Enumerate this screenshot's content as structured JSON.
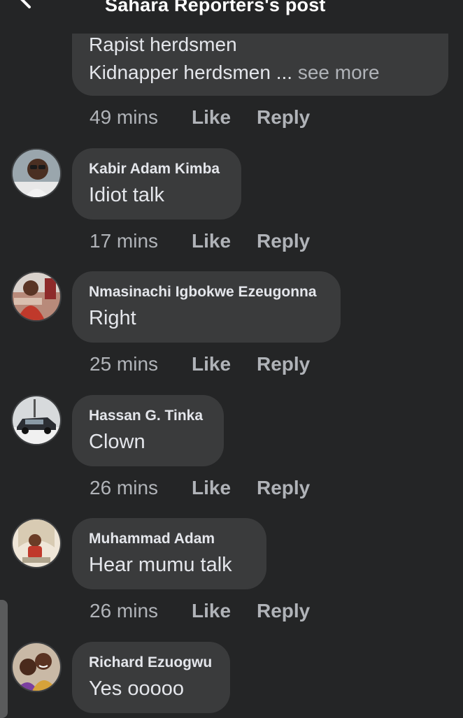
{
  "header": {
    "title": "Sahara Reporters's post"
  },
  "first_comment": {
    "lines": [
      "Rapist herdsmen",
      "Kidnapper herdsmen ..."
    ],
    "see_more": "see more",
    "time": "49 mins"
  },
  "actions": {
    "like": "Like",
    "reply": "Reply"
  },
  "comments": [
    {
      "author": "Kabir Adam Kimba",
      "text": "Idiot talk",
      "time": "17 mins",
      "avatar": "avatar-man-glasses"
    },
    {
      "author": "Nmasinachi Igbokwe Ezeugonna",
      "text": "Right",
      "time": "25 mins",
      "avatar": "avatar-woman-red"
    },
    {
      "author": "Hassan G. Tinka",
      "text": "Clown",
      "time": "26 mins",
      "avatar": "avatar-car"
    },
    {
      "author": "Muhammad Adam",
      "text": "Hear mumu talk",
      "time": "26 mins",
      "avatar": "avatar-child"
    },
    {
      "author": "Richard Ezuogwu",
      "text": "Yes ooooo",
      "time": "",
      "avatar": "avatar-couple"
    }
  ],
  "colors": {
    "background": "#242526",
    "bubble": "#3a3b3c",
    "primary_text": "#e4e6eb",
    "secondary_text": "#b0b3b8"
  }
}
